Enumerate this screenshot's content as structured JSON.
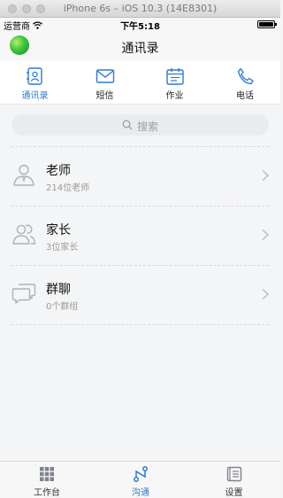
{
  "simulator": {
    "title": "iPhone 6s – iOS 10.3 (14E8301)"
  },
  "status_bar": {
    "carrier": "运营商",
    "time": "下午5:18"
  },
  "nav": {
    "title": "通讯录"
  },
  "tabs": [
    {
      "label": "通讯录",
      "icon": "contacts-icon",
      "active": true
    },
    {
      "label": "短信",
      "icon": "mail-icon",
      "active": false
    },
    {
      "label": "作业",
      "icon": "calendar-icon",
      "active": false
    },
    {
      "label": "电话",
      "icon": "phone-icon",
      "active": false
    }
  ],
  "search": {
    "placeholder": "搜索"
  },
  "groups": [
    {
      "title": "老师",
      "subtitle": "214位老师",
      "icon": "teacher-icon"
    },
    {
      "title": "家长",
      "subtitle": "3位家长",
      "icon": "parents-icon"
    },
    {
      "title": "群聊",
      "subtitle": "0个群组",
      "icon": "group-chat-icon"
    }
  ],
  "bottom_tabs": [
    {
      "label": "工作台",
      "icon": "grid-icon",
      "active": false
    },
    {
      "label": "沟通",
      "icon": "connect-icon",
      "active": true
    },
    {
      "label": "设置",
      "icon": "settings-icon",
      "active": false
    }
  ],
  "colors": {
    "accent": "#2b7ad6",
    "icon_gray": "#a9b3bd"
  }
}
